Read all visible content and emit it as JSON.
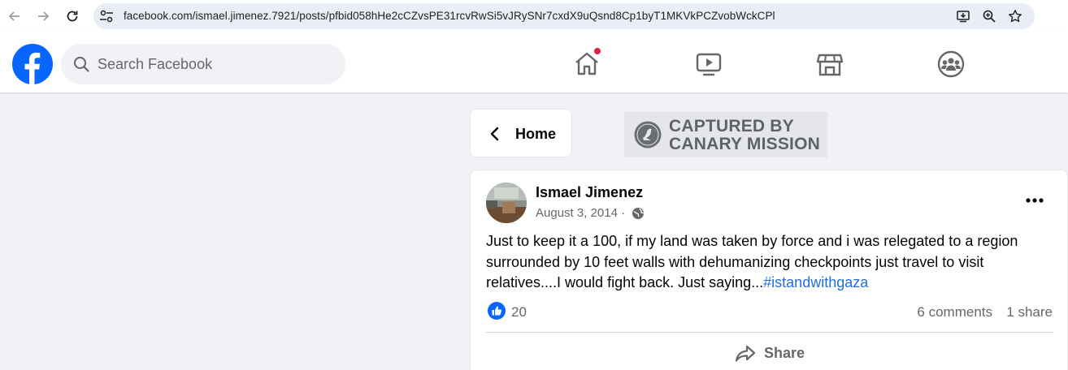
{
  "browser": {
    "url": "facebook.com/ismael.jimenez.7921/posts/pfbid058hHe2cCZvsPE31rcvRwSi5vJRySNr7cxdX9uQsnd8Cp1byT1MKVkPCZvobWckCPl",
    "icons": [
      "back-arrow-icon",
      "forward-arrow-icon",
      "reload-icon",
      "site-info-icon",
      "install-app-icon",
      "zoom-icon",
      "bookmark-star-icon"
    ]
  },
  "header": {
    "search_placeholder": "Search Facebook",
    "nav_icons": [
      "home-icon",
      "video-icon",
      "marketplace-icon",
      "groups-icon"
    ],
    "home_has_notification": true
  },
  "home_card": {
    "label": "Home"
  },
  "watermark": {
    "line1": "CAPTURED BY",
    "line2": "CANARY MISSION"
  },
  "post": {
    "author": "Ismael Jimenez",
    "date": "August 3, 2014 ·",
    "text_line1": "Just to keep it a 100, if my land was taken by force and i was relegated to a region",
    "text_line2": "surrounded by 10 feet walls with dehumanizing checkpoints just travel to visit",
    "text_line3": "relatives....I would fight back. Just saying...",
    "hashtag": "#istandwithgaza",
    "likes": "20",
    "comments": "6 comments",
    "shares": "1 share",
    "share_label": "Share"
  },
  "colors": {
    "facebook_blue": "#0866ff",
    "link_blue": "#216fdb",
    "notification_red": "#e41e3f",
    "page_background": "#f0f2f5"
  }
}
